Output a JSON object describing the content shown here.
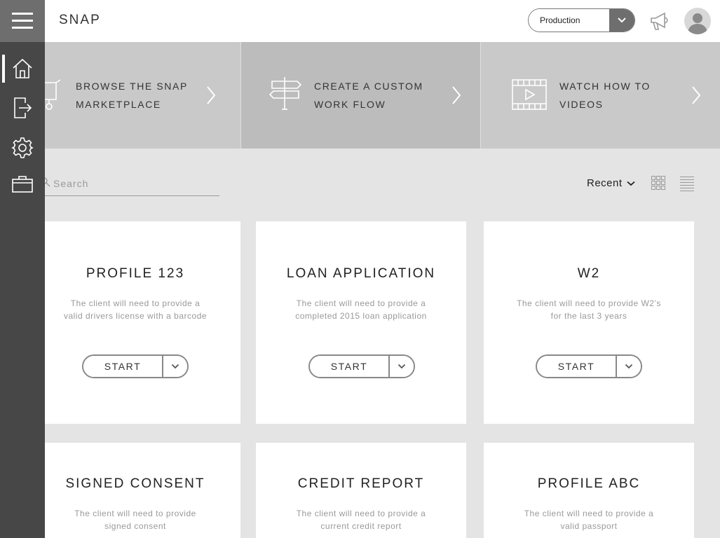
{
  "header": {
    "title": "SNAP",
    "environment": "Production"
  },
  "banner": [
    {
      "line1": "BROWSE THE SNAP",
      "line2": "MARKETPLACE",
      "icon": "cart-icon"
    },
    {
      "line1": "CREATE A CUSTOM",
      "line2": "WORK FLOW",
      "icon": "signpost-icon"
    },
    {
      "line1": "WATCH HOW TO",
      "line2": "VIDEOS",
      "icon": "video-icon"
    }
  ],
  "toolbar": {
    "search_placeholder": "Search",
    "sort_label": "Recent"
  },
  "sidebar": {
    "items": [
      {
        "icon": "home-icon"
      },
      {
        "icon": "logout-icon"
      },
      {
        "icon": "gear-icon"
      },
      {
        "icon": "briefcase-icon"
      }
    ]
  },
  "cards": [
    {
      "title": "PROFILE 123",
      "desc1": "The client will need to provide a",
      "desc2": "valid  drivers license with a barcode",
      "action": "START"
    },
    {
      "title": "LOAN APPLICATION",
      "desc1": "The client will need to provide a",
      "desc2": "completed 2015 loan application",
      "action": "START"
    },
    {
      "title": "W2",
      "desc1": "The client will need to provide W2’s",
      "desc2": "for the last 3 years",
      "action": "START"
    },
    {
      "title": "SIGNED CONSENT",
      "desc1": "The client will need to provide",
      "desc2": "signed consent",
      "action": ""
    },
    {
      "title": "CREDIT REPORT",
      "desc1": "The client will need to provide a",
      "desc2": "current credit report",
      "action": ""
    },
    {
      "title": "PROFILE ABC",
      "desc1": "The client will need to provide a",
      "desc2": "valid passport",
      "action": ""
    }
  ],
  "colors": {
    "sidebar": "#474747",
    "menu_button": "#6e6e6e",
    "page_bg": "#e4e4e4",
    "banner_tile": "#c9c9c9",
    "banner_tile_alt": "#bcbcbc"
  }
}
